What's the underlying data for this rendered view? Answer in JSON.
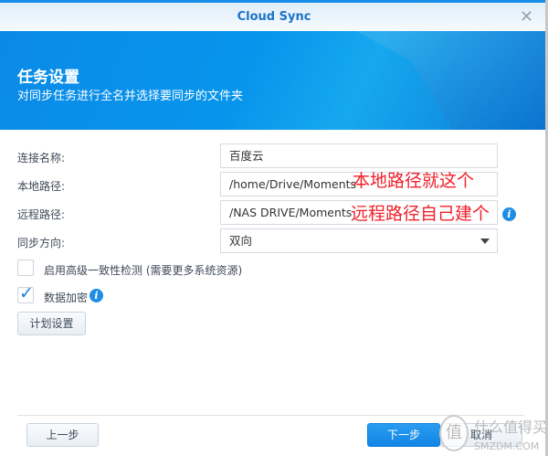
{
  "window": {
    "title": "Cloud Sync",
    "close_icon": "close-icon"
  },
  "banner": {
    "title": "任务设置",
    "subtitle": "对同步任务进行全名并选择要同步的文件夹"
  },
  "form": {
    "connection_name": {
      "label": "连接名称:",
      "value": "百度云"
    },
    "local_path": {
      "label": "本地路径:",
      "value": "/home/Drive/Moments"
    },
    "remote_path": {
      "label": "远程路径:",
      "value": "/NAS DRIVE/Moments"
    },
    "sync_direction": {
      "label": "同步方向:",
      "value": "双向"
    },
    "advanced_check": {
      "label": "启用高级一致性检测 (需要更多系统资源)",
      "checked": false
    },
    "encryption": {
      "label": "数据加密",
      "checked": true
    },
    "schedule_button": "计划设置"
  },
  "annotations": {
    "local": "本地路径就这个",
    "remote": "远程路径自己建个"
  },
  "footer": {
    "back": "上一步",
    "next": "下一步",
    "cancel": "取消"
  },
  "watermark": {
    "glyph": "值",
    "line1": "什么值得买",
    "line2": "SMZDM.COM"
  },
  "colors": {
    "accent": "#1a8ee6",
    "annotation": "#f0202a"
  }
}
